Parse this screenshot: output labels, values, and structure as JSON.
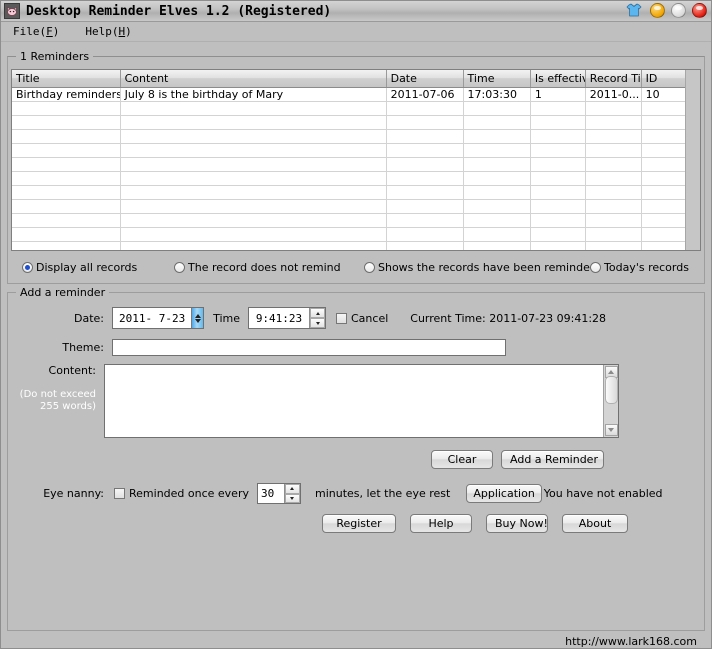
{
  "window": {
    "title": "Desktop Reminder Elves 1.2 (Registered)",
    "app_icon": "app-logo-icon",
    "buttons": {
      "shirt": "shirt-icon",
      "minimize": "minimize-orb-icon",
      "maximize": "maximize-orb-icon",
      "close": "close-orb-icon"
    }
  },
  "menu": {
    "items": [
      {
        "label": "File",
        "mnemonic": "F"
      },
      {
        "label": "Help",
        "mnemonic": "H"
      }
    ]
  },
  "reminders_group": {
    "title": "1  Reminders",
    "columns": [
      "Title",
      "Content",
      "Date",
      "Time",
      "Is effectiv",
      "Record Tir",
      "ID"
    ],
    "rows": [
      {
        "title": "Birthday reminders",
        "content": "July 8 is the birthday of Mary",
        "date": "2011-07-06",
        "time": "17:03:30",
        "is_effective": "1",
        "record_time": "2011-0...",
        "id": "10"
      }
    ],
    "empty_row_count": 11
  },
  "filters": {
    "options": [
      {
        "label": "Display all records",
        "selected": true
      },
      {
        "label": "The record does not remind",
        "selected": false
      },
      {
        "label": "Shows the records have been reminded",
        "selected": false
      },
      {
        "label": "Today's records",
        "selected": false
      }
    ]
  },
  "add_panel": {
    "title": "Add a reminder",
    "date_label": "Date:",
    "date_value": "2011- 7-23",
    "time_label": "Time",
    "time_value": "9:41:23",
    "cancel_label": "Cancel",
    "cancel_checked": false,
    "current_time_label": "Current Time: 2011-07-23 09:41:28",
    "theme_label": "Theme:",
    "theme_value": "",
    "theme_placeholder": "",
    "content_label": "Content:",
    "content_hint": "(Do not exceed 255 words)",
    "content_value": "",
    "content_placeholder": "",
    "clear_label": "Clear",
    "add_label": "Add a Reminder",
    "eye_nanny_label": "Eye nanny:",
    "reminded_label": "Reminded once every",
    "reminded_checked": false,
    "interval_value": "30",
    "minutes_label": "minutes, let the eye rest",
    "application_label": "Application",
    "status_label": "You have not enabled",
    "register_label": "Register",
    "help_label": "Help",
    "buy_label": "Buy Now!",
    "about_label": "About"
  },
  "footer": {
    "url": "http://www.lark168.com"
  },
  "colors": {
    "face": "#bfbfbf",
    "accent_blue": "#1d4fcf",
    "spinner_blue": "#4fa8e8",
    "close_red": "#e01b0e",
    "min_orange": "#f0a400"
  }
}
